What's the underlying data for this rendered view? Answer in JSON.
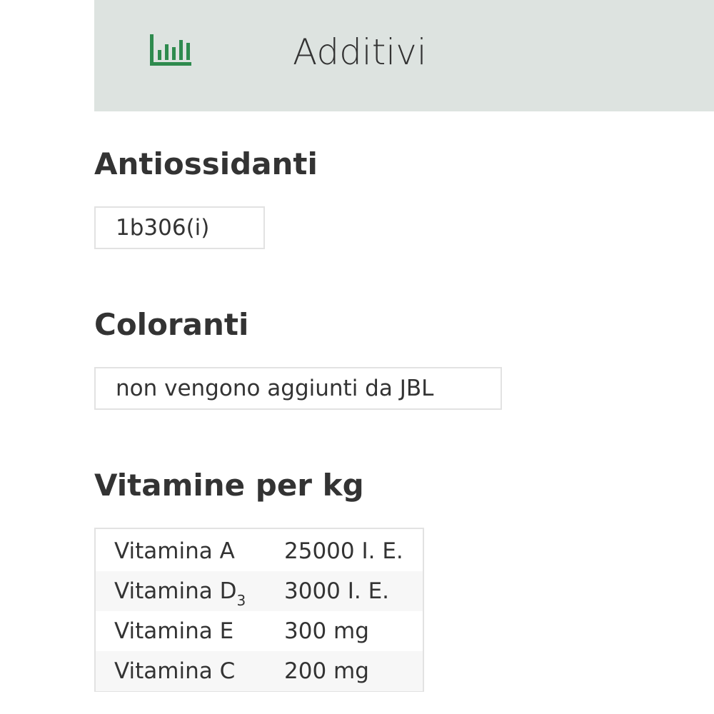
{
  "header": {
    "icon": "bar-chart-icon",
    "icon_color": "#2e8b4e",
    "background": "#dde3e0",
    "title": "Additivi"
  },
  "antioxidants": {
    "heading": "Antiossidanti",
    "value": "1b306(i)"
  },
  "colorants": {
    "heading": "Coloranti",
    "value": "non vengono aggiunti da JBL"
  },
  "vitamins": {
    "heading": "Vitamine per kg",
    "rows": [
      {
        "name": "Vitamina A",
        "value": "25000 I. E."
      },
      {
        "name": "Vitamina D",
        "name_sub": "3",
        "value": "3000 I. E."
      },
      {
        "name": "Vitamina E",
        "value": "300 mg"
      },
      {
        "name": "Vitamina C",
        "value": "200 mg"
      }
    ]
  }
}
